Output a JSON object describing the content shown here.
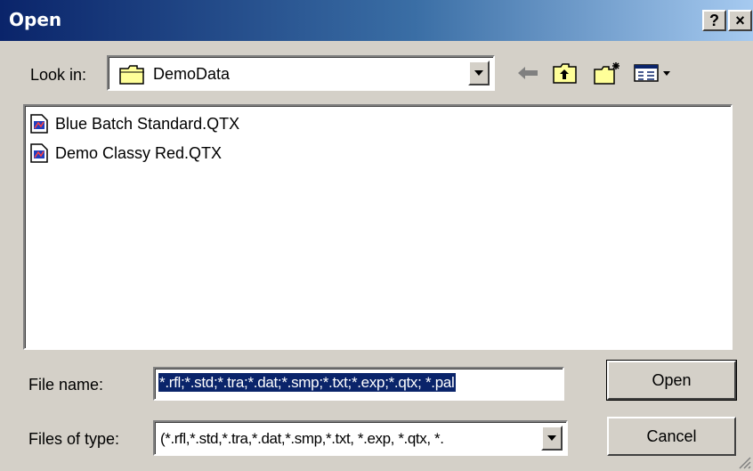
{
  "window": {
    "title": "Open",
    "help_label": "?",
    "close_label": "×"
  },
  "look_in": {
    "label": "Look in:",
    "value": "DemoData"
  },
  "toolbar": {
    "icons": [
      "back-arrow-icon",
      "up-one-level-icon",
      "new-folder-icon",
      "view-menu-icon"
    ]
  },
  "files": [
    {
      "name": "Blue Batch Standard.QTX",
      "icon": "qtx-file-icon"
    },
    {
      "name": "Demo Classy Red.QTX",
      "icon": "qtx-file-icon"
    }
  ],
  "file_name": {
    "label": "File name:",
    "value": "*.rfl;*.std;*.tra;*.dat;*.smp;*.txt;*.exp;*.qtx; *.pal"
  },
  "files_of_type": {
    "label": "Files of type:",
    "value": "(*.rfl,*.std,*.tra,*.dat,*.smp,*.txt, *.exp, *.qtx, *."
  },
  "buttons": {
    "open": "Open",
    "cancel": "Cancel"
  },
  "colors": {
    "title_start": "#0a246a",
    "title_end": "#a6caf0",
    "face": "#d4d0c8",
    "selection": "#0a246a"
  }
}
